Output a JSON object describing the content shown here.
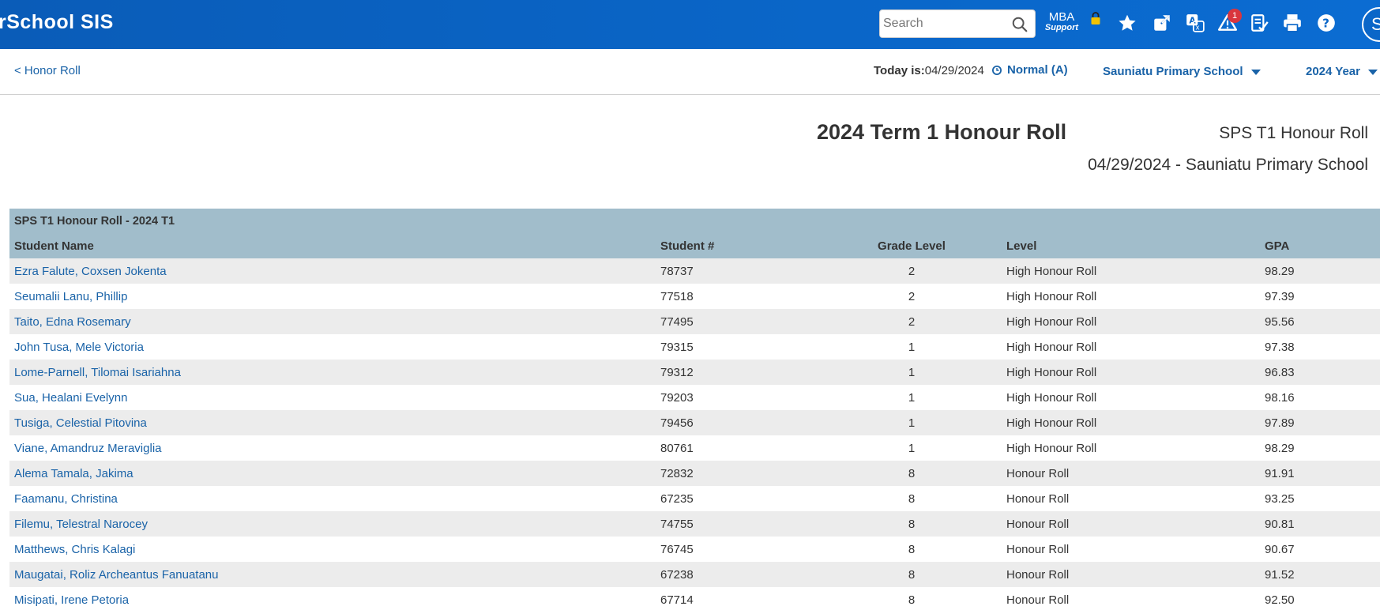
{
  "header": {
    "brand": "rSchool SIS",
    "search_placeholder": "Search",
    "mba_line1": "MBA",
    "mba_line2": "Support",
    "alert_count": "1",
    "avatar_initial": "S"
  },
  "subbar": {
    "back_link": "< Honor Roll",
    "today_label": "Today is:",
    "today_date": "04/29/2024",
    "term": "Normal (A)",
    "school": "Sauniatu Primary School",
    "year": "2024 Year"
  },
  "report": {
    "title": "2024 Term 1 Honour Roll",
    "subtitle": "SPS T1 Honour Roll",
    "date_school": "04/29/2024 - Sauniatu Primary School"
  },
  "table": {
    "caption": "SPS T1 Honour Roll - 2024 T1",
    "columns": [
      "Student Name",
      "Student #",
      "Grade Level",
      "Level",
      "GPA"
    ],
    "rows": [
      [
        "Ezra Falute, Coxsen Jokenta",
        "78737",
        "2",
        "High Honour Roll",
        "98.29"
      ],
      [
        "Seumalii Lanu, Phillip",
        "77518",
        "2",
        "High Honour Roll",
        "97.39"
      ],
      [
        "Taito, Edna Rosemary",
        "77495",
        "2",
        "High Honour Roll",
        "95.56"
      ],
      [
        "John Tusa, Mele Victoria",
        "79315",
        "1",
        "High Honour Roll",
        "97.38"
      ],
      [
        "Lome-Parnell, Tilomai Isariahna",
        "79312",
        "1",
        "High Honour Roll",
        "96.83"
      ],
      [
        "Sua, Healani Evelynn",
        "79203",
        "1",
        "High Honour Roll",
        "98.16"
      ],
      [
        "Tusiga, Celestial Pitovina",
        "79456",
        "1",
        "High Honour Roll",
        "97.89"
      ],
      [
        "Viane, Amandruz Meraviglia",
        "80761",
        "1",
        "High Honour Roll",
        "98.29"
      ],
      [
        "Alema Tamala, Jakima",
        "72832",
        "8",
        "Honour Roll",
        "91.91"
      ],
      [
        "Faamanu, Christina",
        "67235",
        "8",
        "Honour Roll",
        "93.25"
      ],
      [
        "Filemu, Telestral Narocey",
        "74755",
        "8",
        "Honour Roll",
        "90.81"
      ],
      [
        "Matthews, Chris Kalagi",
        "76745",
        "8",
        "Honour Roll",
        "90.67"
      ],
      [
        "Maugatai, Roliz Archeantus Fanuatanu",
        "67238",
        "8",
        "Honour Roll",
        "91.52"
      ],
      [
        "Misipati, Irene Petoria",
        "67714",
        "8",
        "Honour Roll",
        "92.50"
      ]
    ]
  },
  "colors": {
    "topbar": "#0a66c8",
    "link": "#1a63a8",
    "table_header": "#a1bdcb",
    "row_alt": "#ececec",
    "badge": "#d9363e"
  },
  "icons": [
    "search-icon",
    "lock-icon",
    "star-icon",
    "external-link-icon",
    "translate-icon",
    "alert-icon",
    "checklist-icon",
    "print-icon",
    "help-icon",
    "clock-icon"
  ]
}
